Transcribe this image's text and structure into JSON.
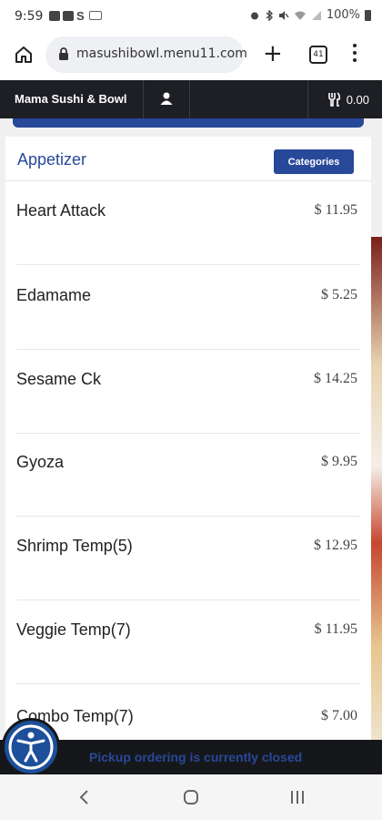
{
  "status_bar": {
    "time": "9:59",
    "battery_text": "100%"
  },
  "browser": {
    "url": "masushibowl.menu11.com",
    "tab_count": "41"
  },
  "site_header": {
    "brand": "Mama Sushi & Bowl",
    "cart_total": "0.00"
  },
  "menu": {
    "section_title": "Appetizer",
    "categories_label": "Categories",
    "items": [
      {
        "name": "Heart Attack",
        "price": "$ 11.95"
      },
      {
        "name": "Edamame",
        "price": "$ 5.25"
      },
      {
        "name": "Sesame Ck",
        "price": "$ 14.25"
      },
      {
        "name": "Gyoza",
        "price": "$ 9.95"
      },
      {
        "name": "Shrimp Temp(5)",
        "price": "$ 12.95"
      },
      {
        "name": "Veggie Temp(7)",
        "price": "$ 11.95"
      },
      {
        "name": "Combo Temp(7)",
        "price": "$ 7.00"
      }
    ]
  },
  "banner": {
    "closed_text": "Pickup ordering is currently closed"
  },
  "colors": {
    "accent": "#28489a",
    "header_bg": "#1e1f24"
  },
  "icons": [
    "home-icon",
    "lock-icon",
    "plus-icon",
    "tabs-icon",
    "more-icon",
    "user-icon",
    "cutlery-icon",
    "accessibility-icon",
    "back-icon",
    "home-circle-icon",
    "recents-icon"
  ]
}
